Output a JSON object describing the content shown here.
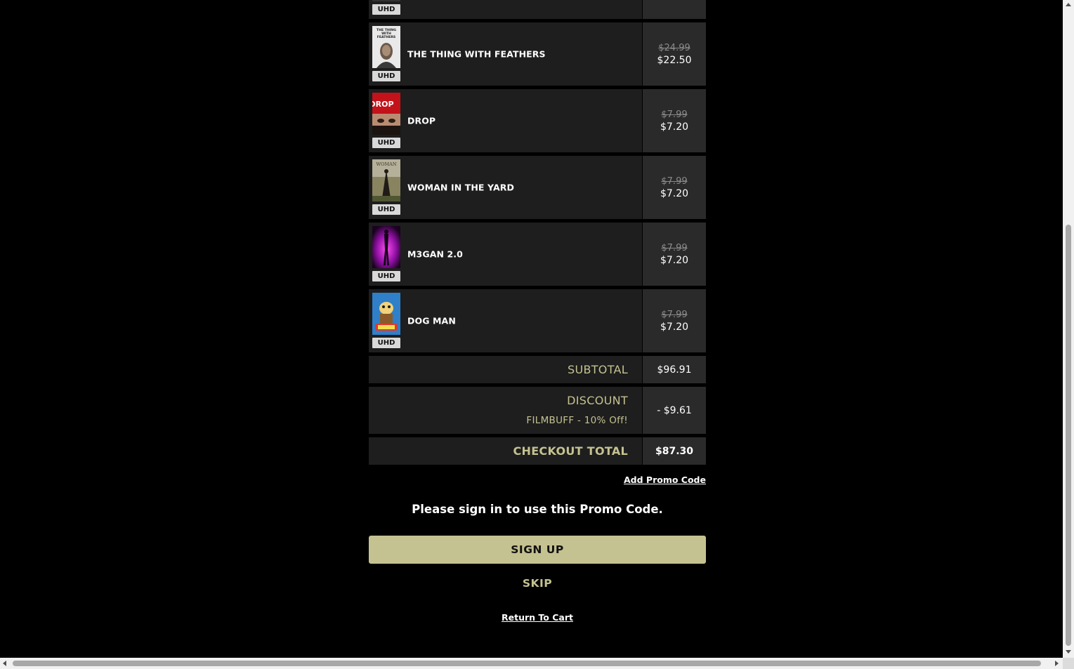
{
  "items": [
    {
      "title": "",
      "badge": "UHD",
      "old_price": "",
      "new_price": ""
    },
    {
      "title": "THE THING WITH FEATHERS",
      "badge": "UHD",
      "old_price": "$24.99",
      "new_price": "$22.50"
    },
    {
      "title": "DROP",
      "badge": "UHD",
      "old_price": "$7.99",
      "new_price": "$7.20"
    },
    {
      "title": "WOMAN IN THE YARD",
      "badge": "UHD",
      "old_price": "$7.99",
      "new_price": "$7.20"
    },
    {
      "title": "M3GAN 2.0",
      "badge": "UHD",
      "old_price": "$7.99",
      "new_price": "$7.20"
    },
    {
      "title": "DOG MAN",
      "badge": "UHD",
      "old_price": "$7.99",
      "new_price": "$7.20"
    }
  ],
  "posters": {
    "feathers_text": "THE THING WITH FEATHERS",
    "drop_text": "DROP",
    "woman_text": "WOMAN IN THE YARD"
  },
  "summary": {
    "subtotal_label": "SUBTOTAL",
    "subtotal_value": "$96.91",
    "discount_label": "DISCOUNT",
    "discount_code": "FILMBUFF - 10% Off!",
    "discount_value": "- $9.61",
    "total_label": "CHECKOUT TOTAL",
    "total_value": "$87.30"
  },
  "promo": {
    "add_link": "Add Promo Code",
    "sign_in_message": "Please sign in to use this Promo Code.",
    "sign_up_button": "SIGN UP",
    "skip_button": "SKIP",
    "return_link": "Return To Cart"
  },
  "colors": {
    "accent": "#c5c291",
    "row_bg": "#1e1e1e",
    "price_bg": "#2a2a2a",
    "page_bg": "#000000"
  }
}
